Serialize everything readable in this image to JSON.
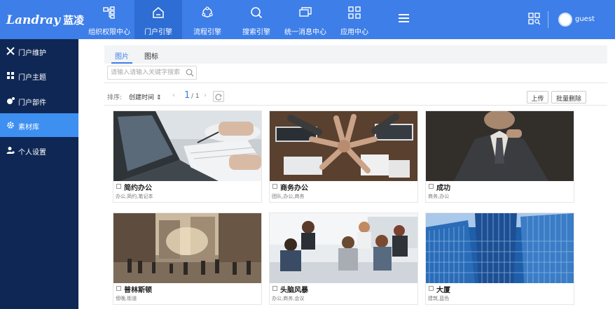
{
  "header": {
    "logo_en": "Landray",
    "logo_cn": "蓝凌",
    "nav": [
      {
        "label": "组织权限中心",
        "icon": "org-icon"
      },
      {
        "label": "门户引擎",
        "icon": "home-icon"
      },
      {
        "label": "流程引擎",
        "icon": "flow-icon"
      },
      {
        "label": "搜索引擎",
        "icon": "search-icon"
      },
      {
        "label": "统一消息中心",
        "icon": "message-icon"
      },
      {
        "label": "应用中心",
        "icon": "grid-icon"
      }
    ],
    "active_nav": "门户引擎",
    "user": "guest",
    "accent": "#3d7ee8"
  },
  "sidebar": {
    "items": [
      {
        "label": "门户维护",
        "icon": "tools-icon"
      },
      {
        "label": "门户主题",
        "icon": "theme-icon"
      },
      {
        "label": "门户部件",
        "icon": "widget-icon"
      },
      {
        "label": "素材库",
        "icon": "gear-icon"
      },
      {
        "label": "个人设置",
        "icon": "user-settings-icon"
      }
    ],
    "active": "素材库",
    "bg": "#0f2754",
    "active_bg": "#3d8ff0"
  },
  "tabs": [
    {
      "label": "图片"
    },
    {
      "label": "图标"
    }
  ],
  "search": {
    "placeholder": "请输入请输入关键字搜索"
  },
  "toolbar": {
    "sort_label": "排序:",
    "sort_value": "创建时间 ⇕",
    "page_current": "1",
    "page_total": "/ 1",
    "upload": "上传",
    "batch_delete": "批量删除"
  },
  "cards": [
    {
      "title": "简约办公",
      "tags": "办公,简约,笔记本"
    },
    {
      "title": "商务办公",
      "tags": "团队,办公,商务"
    },
    {
      "title": "成功",
      "tags": "商务,办公"
    },
    {
      "title": "普林斯顿",
      "tags": "傍晚,街道"
    },
    {
      "title": "头脑风暴",
      "tags": "办公,商务,会议"
    },
    {
      "title": "大厦",
      "tags": "建筑,蓝色"
    }
  ]
}
